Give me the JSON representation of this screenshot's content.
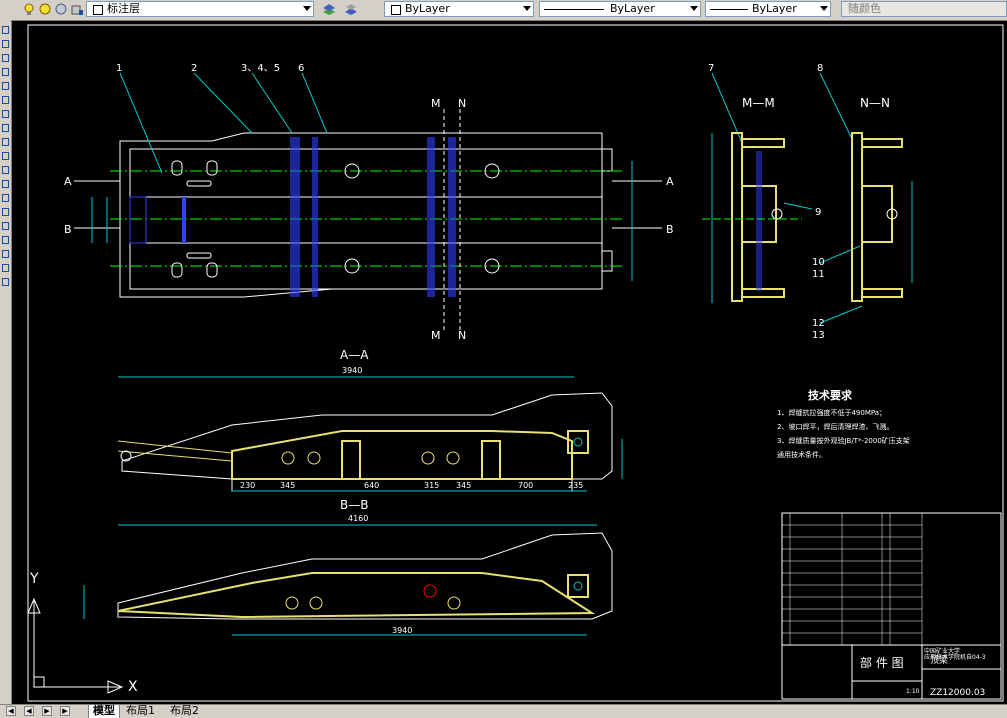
{
  "toolbar": {
    "layer_name": "标注层",
    "color_control": "ByLayer",
    "linetype_control": "ByLayer",
    "lineweight_control": "ByLayer",
    "plotstyle_control": "随颜色"
  },
  "drawing": {
    "section_mm": "M—M",
    "section_nn": "N—N",
    "section_aa": "A—A",
    "section_bb": "B—B",
    "cut_m": "M",
    "cut_n": "N",
    "cut_a": "A",
    "cut_b": "B",
    "callouts": [
      "1",
      "2",
      "3、4、5",
      "6",
      "7",
      "8",
      "9",
      "10",
      "11",
      "12",
      "13"
    ],
    "dims_aa": [
      "3940",
      "230",
      "345",
      "640",
      "315",
      "345",
      "700",
      "235"
    ],
    "dims_bb_top": "4160",
    "dims_bb_bottom": "3940",
    "tech_title": "技术要求",
    "tech_notes": [
      "1、焊缝抗拉强度不低于490MPa；",
      "2、坡口焊平，焊后清理焊渣、飞溅。",
      "3、焊缝质量按外观验JB/T*-2000矿压支架",
      "   通用技术条件。"
    ],
    "title_block": {
      "title": "部 件 图",
      "part_name": "顶梁",
      "school_line1": "中国矿业大学",
      "school_line2": "应用技术学院机自04-3",
      "drawing_no": "ZZ12000.03",
      "scale": "1:10"
    },
    "axis_x": "X",
    "axis_y": "Y"
  },
  "tabs": [
    "模型",
    "布局1",
    "布局2"
  ],
  "colors": {
    "canvas_bg": "#000000",
    "outline": "#ffffff",
    "weld": "#e8e070",
    "center_line": "#00ff00",
    "section_blue": "#3040ff",
    "dim_cyan": "#00c8c8",
    "section_red": "#ff0000"
  }
}
